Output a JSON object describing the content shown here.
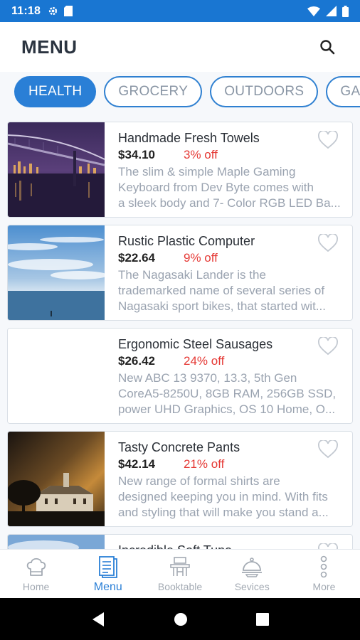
{
  "status_bar": {
    "time": "11:18",
    "bg_color": "#1976d2"
  },
  "header": {
    "title": "MENU"
  },
  "tabs": [
    {
      "label": "HEALTH",
      "active": true
    },
    {
      "label": "GROCERY",
      "active": false
    },
    {
      "label": "OUTDOORS",
      "active": false
    },
    {
      "label": "GARD",
      "active": false
    }
  ],
  "products": [
    {
      "name": "Handmade Fresh Towels",
      "price": "$34.10",
      "discount": "3% off",
      "desc": [
        "The slim & simple Maple Gaming",
        "Keyboard from Dev Byte comes with",
        "a sleek body and 7- Color RGB LED Ba..."
      ],
      "image": "city-bridge-night"
    },
    {
      "name": "Rustic Plastic Computer",
      "price": "$22.64",
      "discount": "9% off",
      "desc": [
        "The Nagasaki Lander is the",
        "trademarked name of several series of",
        "Nagasaki sport bikes, that started wit..."
      ],
      "image": "sky-sea"
    },
    {
      "name": "Ergonomic Steel Sausages",
      "price": "$26.42",
      "discount": "24% off",
      "desc": [
        "New ABC 13 9370, 13.3, 5th Gen",
        "CoreA5-8250U, 8GB RAM, 256GB SSD,",
        "power UHD Graphics, OS 10 Home, O..."
      ],
      "image": "blank"
    },
    {
      "name": "Tasty Concrete Pants",
      "price": "$42.14",
      "discount": "21% off",
      "desc": [
        "New range of formal shirts are",
        "designed keeping you in mind. With fits",
        "and styling that will make you stand a..."
      ],
      "image": "church-dusk"
    },
    {
      "name": "Incredible Soft Tuna",
      "price": "",
      "discount": "",
      "desc": [
        "",
        "",
        ""
      ],
      "image": "sky-blue"
    }
  ],
  "bottom_nav": [
    {
      "label": "Home",
      "icon": "chef-hat-icon",
      "active": false
    },
    {
      "label": "Menu",
      "icon": "menu-book-icon",
      "active": true
    },
    {
      "label": "Booktable",
      "icon": "table-icon",
      "active": false
    },
    {
      "label": "Sevices",
      "icon": "cloche-icon",
      "active": false
    },
    {
      "label": "More",
      "icon": "more-vertical-icon",
      "active": false
    }
  ],
  "colors": {
    "accent": "#2a7fd6",
    "discount": "#e53935",
    "muted": "#9aa3b0"
  }
}
